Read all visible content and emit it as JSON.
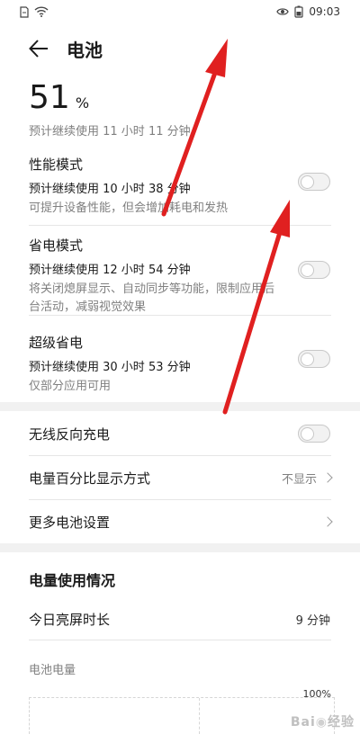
{
  "status_bar": {
    "time": "09:03"
  },
  "header": {
    "title": "电池"
  },
  "battery": {
    "percent": "51",
    "unit": "%",
    "remaining": "预计继续使用 11 小时 11 分钟"
  },
  "modes": [
    {
      "title": "性能模式",
      "line": "预计继续使用 10 小时 38 分钟",
      "desc": "可提升设备性能，但会增加耗电和发热",
      "enabled": false
    },
    {
      "title": "省电模式",
      "line": "预计继续使用 12 小时 54 分钟",
      "desc": "将关闭熄屏显示、自动同步等功能，限制应用后台活动，减弱视觉效果",
      "enabled": false
    },
    {
      "title": "超级省电",
      "line": "预计继续使用 30 小时 53 分钟",
      "desc": "仅部分应用可用",
      "enabled": false
    }
  ],
  "settings": [
    {
      "label": "无线反向充电",
      "enabled": false
    },
    {
      "label": "电量百分比显示方式",
      "value": "不显示"
    },
    {
      "label": "更多电池设置"
    }
  ],
  "usage": {
    "title": "电量使用情况",
    "screen_time_label": "今日亮屏时长",
    "screen_time_value": "9 分钟",
    "chart_label": "电池电量",
    "chart_top_tick": "100%"
  },
  "watermark": "Baidu经验",
  "annotations": {
    "arrow_color": "#e02020"
  }
}
